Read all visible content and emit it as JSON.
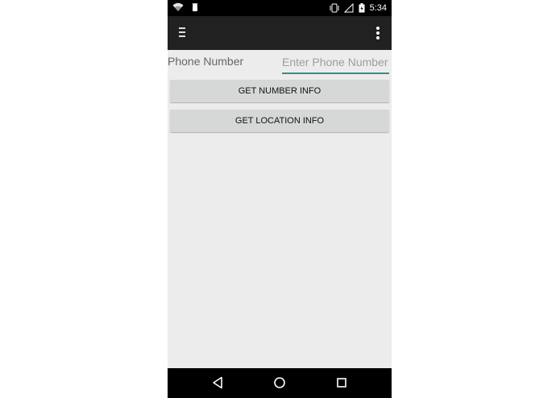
{
  "status_bar": {
    "time": "5:34",
    "icons": [
      "wifi-icon",
      "android-debug-icon",
      "vibrate-icon",
      "no-signal-icon",
      "battery-charging-icon"
    ]
  },
  "app_bar": {
    "menu_icon": "menu-icon",
    "overflow_icon": "more-vert-icon"
  },
  "form": {
    "phone_label": "Phone Number",
    "phone_input_value": "",
    "phone_input_placeholder": "Enter Phone Number"
  },
  "buttons": {
    "number_info": "GET NUMBER INFO",
    "location_info": "GET LOCATION INFO"
  },
  "nav_bar": {
    "icons": [
      "back-icon",
      "home-icon",
      "recents-icon"
    ]
  },
  "colors": {
    "status_bar": "#000000",
    "app_bar": "#212121",
    "background": "#ececec",
    "button": "#d6d7d7",
    "accent": "#3b8c7f"
  }
}
